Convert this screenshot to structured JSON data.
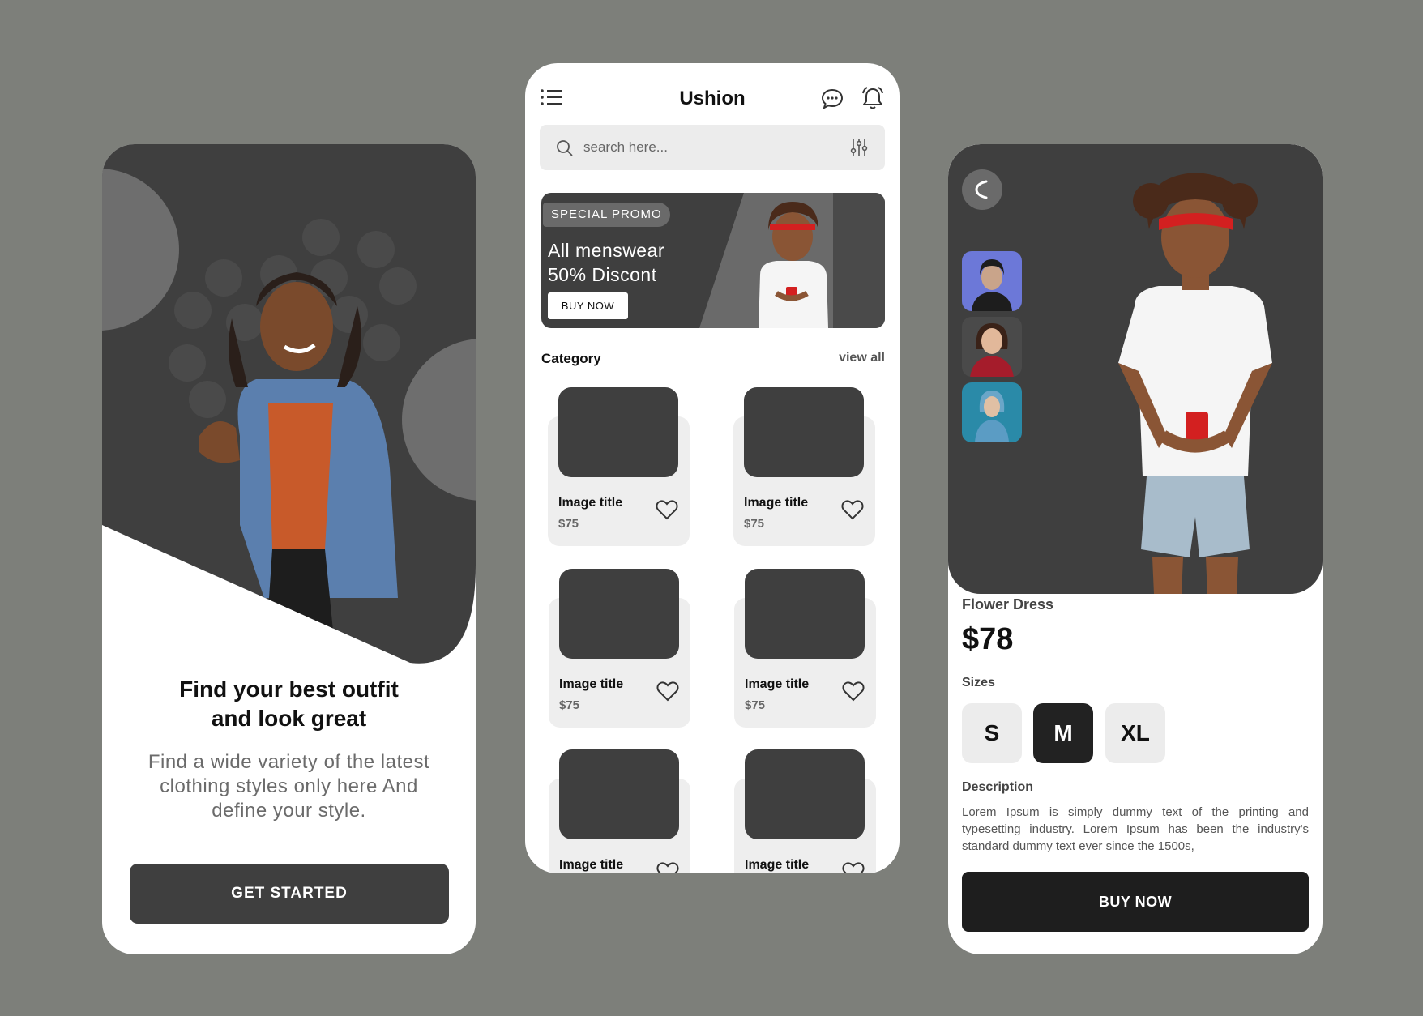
{
  "colors": {
    "background": "#7d7f7a",
    "dark": "#3f3f3f",
    "accent_dark": "#1e1e1e",
    "card": "#eeeeee"
  },
  "onboarding": {
    "title_line1": "Find your best outfit",
    "title_line2": "and look great",
    "subtitle": "Find a wide variety of the latest clothing styles only here And define your style.",
    "cta_label": "GET STARTED"
  },
  "home": {
    "app_title": "Ushion",
    "icons": [
      "menu-icon",
      "chat-icon",
      "bell-icon",
      "search-icon",
      "filter-icon",
      "heart-icon"
    ],
    "search": {
      "placeholder": "search here..."
    },
    "promo": {
      "badge": "SPECIAL PROMO",
      "line1": "All menswear",
      "line2": "50% Discont",
      "button": "BUY NOW"
    },
    "category_label": "Category",
    "view_all": "view all",
    "cards": [
      {
        "title": "Image title",
        "price": "$75"
      },
      {
        "title": "Image title",
        "price": "$75"
      },
      {
        "title": "Image title",
        "price": "$75"
      },
      {
        "title": "Image title",
        "price": "$75"
      },
      {
        "title": "Image title",
        "price": ""
      },
      {
        "title": "Image title",
        "price": ""
      }
    ]
  },
  "detail": {
    "product_name": "Flower Dress",
    "price": "$78",
    "sizes_label": "Sizes",
    "sizes": [
      "S",
      "M",
      "XL"
    ],
    "selected_size": "M",
    "description_label": "Description",
    "description": "Lorem Ipsum is simply dummy text of the printing and typesetting industry. Lorem Ipsum has been the industry's standard dummy text ever since the 1500s,",
    "buy_label": "BUY NOW"
  }
}
